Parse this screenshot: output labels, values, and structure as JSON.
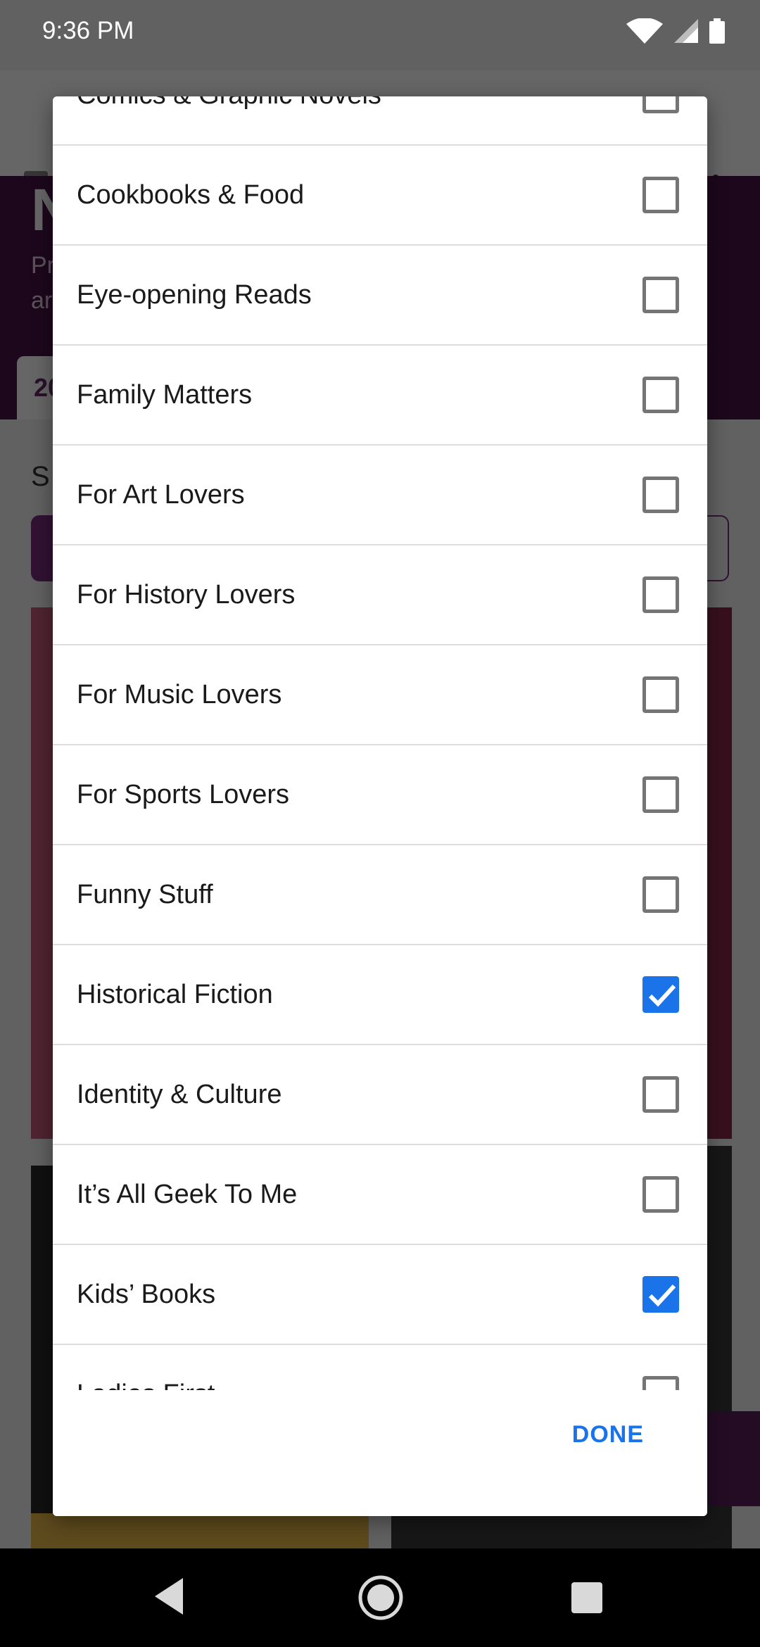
{
  "status_bar": {
    "time": "9:36 PM",
    "icons": [
      "wifi-icon",
      "cellular-signal-icon",
      "battery-icon"
    ]
  },
  "background": {
    "hero_title": "N",
    "hero_line_1": "Pr",
    "hero_line_2": "ar",
    "tab_label": "20",
    "section_label": "S"
  },
  "dialog": {
    "items": [
      {
        "label": "Comics & Graphic Novels",
        "checked": false
      },
      {
        "label": "Cookbooks & Food",
        "checked": false
      },
      {
        "label": "Eye-opening Reads",
        "checked": false
      },
      {
        "label": "Family Matters",
        "checked": false
      },
      {
        "label": "For Art Lovers",
        "checked": false
      },
      {
        "label": "For History Lovers",
        "checked": false
      },
      {
        "label": "For Music Lovers",
        "checked": false
      },
      {
        "label": "For Sports Lovers",
        "checked": false
      },
      {
        "label": "Funny Stuff",
        "checked": false
      },
      {
        "label": "Historical Fiction",
        "checked": true
      },
      {
        "label": "Identity & Culture",
        "checked": false
      },
      {
        "label": "It’s All Geek To Me",
        "checked": false
      },
      {
        "label": "Kids’ Books",
        "checked": true
      },
      {
        "label": "Ladies First",
        "checked": false
      }
    ],
    "done_label": "DONE"
  },
  "colors": {
    "accent": "#1a73e8",
    "hero_background": "#4a1248"
  },
  "nav_bar": {
    "icons": [
      "back-icon",
      "home-icon",
      "recents-icon"
    ]
  }
}
